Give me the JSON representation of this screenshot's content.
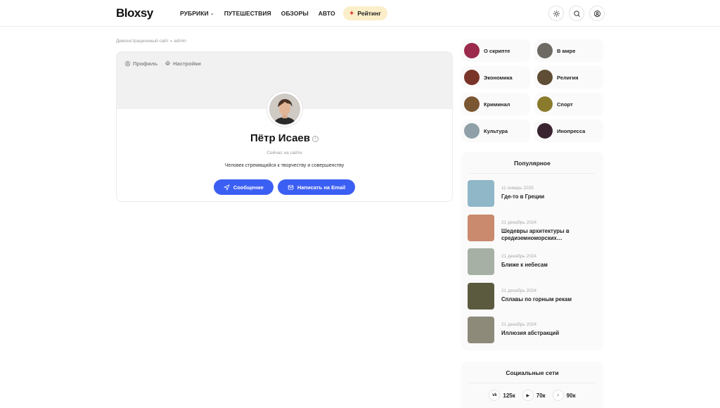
{
  "header": {
    "logo": "Bloxsy",
    "nav": [
      {
        "label": "РУБРИКИ",
        "has_dropdown": true
      },
      {
        "label": "ПУТЕШЕСТВИЯ"
      },
      {
        "label": "ОБЗОРЫ"
      },
      {
        "label": "АВТО"
      }
    ],
    "rating_label": "Рейтинг",
    "icons": [
      "sun-icon",
      "search-icon",
      "user-icon"
    ]
  },
  "breadcrumb": "Демонстрационный сайт » admin",
  "profile": {
    "tabs": [
      {
        "label": "Профиль",
        "icon": "user-icon"
      },
      {
        "label": "Настройки",
        "icon": "gear-icon"
      }
    ],
    "name": "Пётр Исаев",
    "status": "Сейчас на сайте",
    "bio": "Человек стремящийся к творчеству и совершенству",
    "message_button": "Сообщение",
    "email_button": "Написать на Email"
  },
  "categories": [
    {
      "label": "О скрипте",
      "color": "#9b2a4d"
    },
    {
      "label": "В мире",
      "color": "#6d6a63"
    },
    {
      "label": "Экономика",
      "color": "#7a3328"
    },
    {
      "label": "Религия",
      "color": "#5f4d35"
    },
    {
      "label": "Криминал",
      "color": "#7b5632"
    },
    {
      "label": "Спорт",
      "color": "#8a7a2c"
    },
    {
      "label": "Культура",
      "color": "#8fa0a8"
    },
    {
      "label": "Инопресса",
      "color": "#3a2431"
    }
  ],
  "popular": {
    "title": "Популярное",
    "items": [
      {
        "date": "11 январь 2025",
        "title": "Где-то в Греции",
        "color": "#8fb7c7"
      },
      {
        "date": "21 декабрь 2024",
        "title": "Шедевры архитектуры в средиземноморских…",
        "color": "#c98a6e"
      },
      {
        "date": "21 декабрь 2024",
        "title": "Ближе к небесам",
        "color": "#a7b0a4"
      },
      {
        "date": "21 декабрь 2024",
        "title": "Сплавы по горным рекам",
        "color": "#5b5a3e"
      },
      {
        "date": "21 декабрь 2024",
        "title": "Иллюзия абстракций",
        "color": "#8e8a7a"
      }
    ]
  },
  "social": {
    "title": "Социальные сети",
    "items": [
      {
        "icon": "vk-icon",
        "glyph": "vk",
        "count": "125к"
      },
      {
        "icon": "youtube-icon",
        "glyph": "▶",
        "count": "70к"
      },
      {
        "icon": "tiktok-icon",
        "glyph": "♪",
        "count": "90к"
      }
    ]
  }
}
